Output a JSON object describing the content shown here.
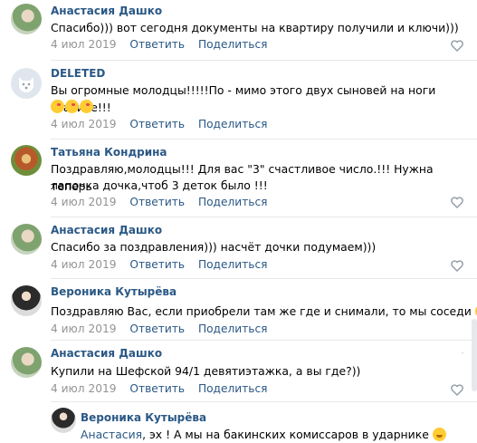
{
  "comments": [
    {
      "author": "Анастасия Дашко",
      "text": "Спасибо))) вот сегодня документы на квартиру получили и ключи)))",
      "date": "4 июл 2019",
      "reply": "Ответить",
      "share": "Поделиться",
      "avatar": "photo"
    },
    {
      "author": "DELETED",
      "text": "Вы огромные молодцы!!!!!По - мимо этого двух сыновей на ноги ставите!!!",
      "emojis": [
        "kiss-emoji",
        "kiss-emoji",
        "kiss-emoji"
      ],
      "date": "4 июл 2019",
      "reply": "Ответить",
      "share": "Поделиться",
      "avatar": "deleted-dog"
    },
    {
      "author": "Татьяна Кондрина",
      "text_line1": "Поздравляю,молодцы!!! Для вас \"3\" счастливое число.!!! Нужна теперь",
      "text_line2": "лапочка дочка,чтоб 3 деток было !!!",
      "date": "4 июл 2019",
      "reply": "Ответить",
      "share": "Поделиться",
      "avatar": "photo"
    },
    {
      "author": "Анастасия Дашко",
      "text": "Спасибо за поздравления))) насчёт дочки подумаем)))",
      "date": "4 июл 2019",
      "reply": "Ответить",
      "share": "Поделиться",
      "avatar": "photo"
    },
    {
      "author": "Вероника Кутырёва",
      "text": "Поздравляю Вас, если приобрели там же где и снимали, то мы соседи",
      "emojis": [
        "wink-emoji"
      ],
      "date": "4 июл 2019",
      "reply": "Ответить",
      "share": "Поделиться",
      "avatar": "photo"
    },
    {
      "author": "Анастасия Дашко",
      "text": "Купили на Шефской 94/1 девятиэтажка, а вы где?))",
      "date": "4 июл 2019",
      "reply": "Ответить",
      "share": "Поделиться",
      "avatar": "photo"
    }
  ],
  "reply_comment": {
    "author": "Вероника Кутырёва",
    "mention": "Анастасия",
    "text": ", эх ! А мы на бакинских комиссаров в ударнике",
    "emojis": [
      "smile-emoji"
    ],
    "avatar": "photo"
  },
  "colors": {
    "link": "#2a5885",
    "meta": "#939393",
    "separator": "#e7e8ec"
  }
}
